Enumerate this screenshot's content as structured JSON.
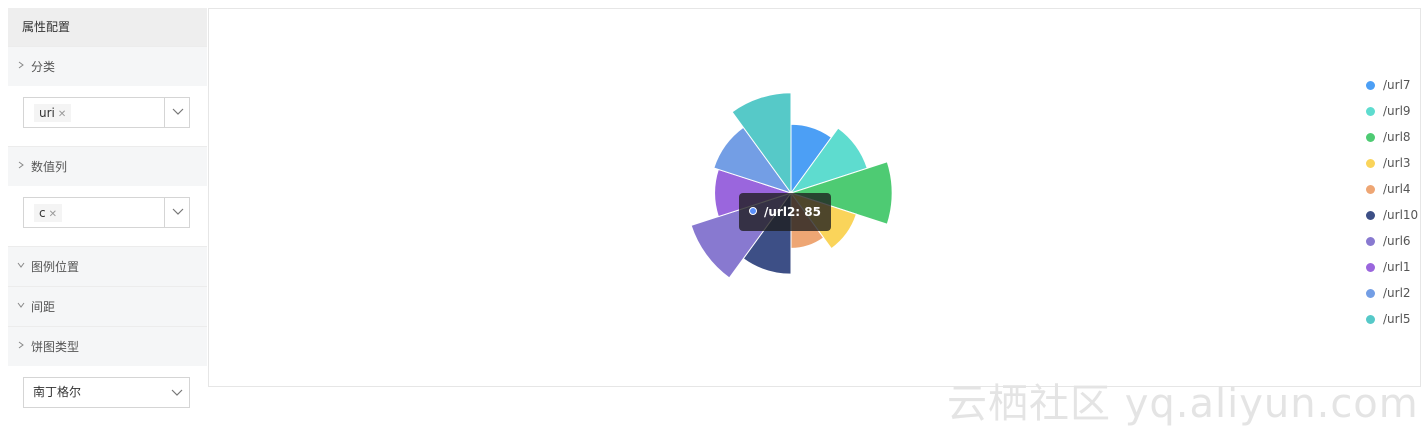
{
  "panel": {
    "title": "属性配置",
    "sections": {
      "category": {
        "label": "分类",
        "tag": "uri",
        "expanded": false
      },
      "value": {
        "label": "数值列",
        "tag": "c",
        "expanded": false
      },
      "legend_position": {
        "label": "图例位置",
        "expanded": true
      },
      "spacing": {
        "label": "间距",
        "expanded": true
      },
      "pie_type": {
        "label": "饼图类型",
        "selected": "南丁格尔",
        "expanded": false
      }
    }
  },
  "chart_data": {
    "type": "pie",
    "variant": "nightingale-rose",
    "series": [
      {
        "name": "/url7",
        "value": 72,
        "color": "#4c9ff5"
      },
      {
        "name": "/url9",
        "value": 84,
        "color": "#5edccf"
      },
      {
        "name": "/url8",
        "value": 106,
        "color": "#4ecb73"
      },
      {
        "name": "/url3",
        "value": 72,
        "color": "#fad45a"
      },
      {
        "name": "/url4",
        "value": 58,
        "color": "#eea674"
      },
      {
        "name": "/url10",
        "value": 85,
        "color": "#3d4f86"
      },
      {
        "name": "/url6",
        "value": 110,
        "color": "#8879d0"
      },
      {
        "name": "/url1",
        "value": 80,
        "color": "#9a66dd"
      },
      {
        "name": "/url2",
        "value": 85,
        "color": "#739ee5"
      },
      {
        "name": "/url5",
        "value": 105,
        "color": "#56c9c8"
      }
    ],
    "legend_position": "right",
    "tooltip": {
      "text": "/url2: 85"
    }
  },
  "watermark": "云栖社区 yq.aliyun.com"
}
